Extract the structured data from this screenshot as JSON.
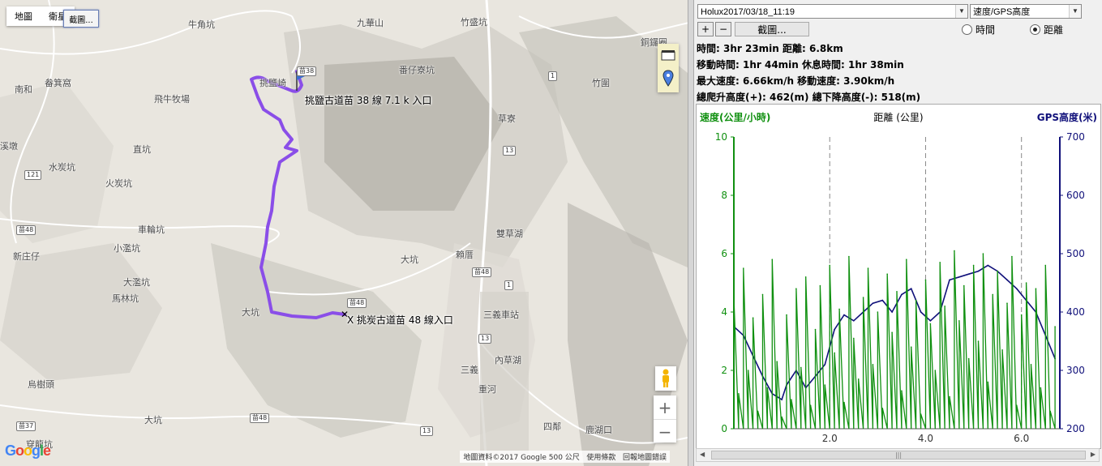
{
  "map": {
    "type_tabs": [
      "地圖",
      "衛星"
    ],
    "screenshot_label": "截圖...",
    "attribution": "地圖資料©2017 Google  500 公尺",
    "terms": "使用條款",
    "report": "回報地圖錯誤",
    "google_logo": "Google",
    "labels": [
      {
        "text": "牛角坑"
      },
      {
        "text": "九華山"
      },
      {
        "text": "竹盛坑"
      },
      {
        "text": "銅鑼圈"
      },
      {
        "text": "南和"
      },
      {
        "text": "畚箕窩"
      },
      {
        "text": "番仔寮坑"
      },
      {
        "text": "挑鹽崎"
      },
      {
        "text": "飛牛牧場"
      },
      {
        "text": "竹圍"
      },
      {
        "text": "溪墩"
      },
      {
        "text": "直坑"
      },
      {
        "text": "草寮"
      },
      {
        "text": "水炭坑"
      },
      {
        "text": "火炭坑"
      },
      {
        "text": "車輪坑"
      },
      {
        "text": "雙草湖"
      },
      {
        "text": "小濫坑"
      },
      {
        "text": "新庄仔"
      },
      {
        "text": "賴厝"
      },
      {
        "text": "大坑"
      },
      {
        "text": "大濫坑"
      },
      {
        "text": "馬林坑"
      },
      {
        "text": "大坑"
      },
      {
        "text": "三義車站"
      },
      {
        "text": "內草湖"
      },
      {
        "text": "三義"
      },
      {
        "text": "烏樹頭"
      },
      {
        "text": "重河"
      },
      {
        "text": "大坑"
      },
      {
        "text": "四鄰"
      },
      {
        "text": "鹿湖口"
      },
      {
        "text": "穿龍坑"
      }
    ],
    "shields": [
      "苗38",
      "121",
      "苗48",
      "苗48",
      "苗48",
      "13",
      "13",
      "苗48",
      "苗37",
      "13",
      "1",
      "1"
    ],
    "route_labels": {
      "start": "挑鹽古道苗 38 線 7.1 k 入口",
      "end": "X 挑炭古道苗 48 線入口"
    },
    "route_color": "#8a4ee8"
  },
  "panel": {
    "track_select": "Holux2017/03/18_11:19",
    "mode_select": "速度/GPS高度",
    "zoom_in": "+",
    "zoom_out": "−",
    "screenshot_button": "截圖...",
    "radio_time": "時間",
    "radio_distance": "距離",
    "radio_selected": "distance",
    "stats": {
      "line1": "時間: 3hr 23min  距離: 6.8km",
      "line2": "移動時間: 1hr 44min  休息時間: 1hr 38min",
      "line3": "最大速度: 6.66km/h  移動速度: 3.90km/h",
      "line4": "總爬升高度(+): 462(m)  總下降高度(-): 518(m)"
    }
  },
  "chart_data": {
    "type": "line",
    "xlabel": "距離 (公里)",
    "ylabel_left": "速度(公里/小時)",
    "ylabel_right": "GPS高度(米)",
    "xlim": [
      0,
      6.8
    ],
    "ylim_left": [
      0,
      10
    ],
    "ylim_right": [
      200,
      700
    ],
    "x_ticks": [
      "2.0",
      "4.0",
      "6.0"
    ],
    "y_ticks_left": [
      "0",
      "2",
      "4",
      "6",
      "8",
      "10"
    ],
    "y_ticks_right": [
      "200",
      "300",
      "400",
      "500",
      "600",
      "700"
    ],
    "colors": {
      "speed": "#109010",
      "altitude": "#10107a",
      "left_axis": "#109010",
      "right_axis": "#10107a"
    },
    "series": [
      {
        "axis": "right",
        "x": [
          0,
          0.2,
          0.4,
          0.6,
          0.8,
          1.0,
          1.1,
          1.3,
          1.5,
          1.7,
          1.9,
          2.1,
          2.3,
          2.5,
          2.7,
          2.9,
          3.1,
          3.3,
          3.5,
          3.7,
          3.9,
          4.1,
          4.3,
          4.5,
          4.7,
          4.9,
          5.1,
          5.3,
          5.5,
          5.7,
          5.9,
          6.1,
          6.3,
          6.5,
          6.7
        ],
        "y": [
          375,
          360,
          325,
          290,
          260,
          250,
          275,
          300,
          270,
          290,
          310,
          370,
          395,
          385,
          400,
          415,
          420,
          400,
          430,
          440,
          400,
          385,
          400,
          455,
          460,
          465,
          470,
          480,
          470,
          455,
          440,
          420,
          400,
          360,
          320
        ]
      },
      {
        "axis": "left",
        "x": [
          0,
          0.1,
          0.2,
          0.3,
          0.4,
          0.5,
          0.6,
          0.7,
          0.8,
          0.9,
          1.0,
          1.1,
          1.2,
          1.3,
          1.4,
          1.5,
          1.6,
          1.7,
          1.8,
          1.9,
          2.0,
          2.1,
          2.2,
          2.3,
          2.4,
          2.5,
          2.6,
          2.7,
          2.8,
          2.9,
          3.0,
          3.1,
          3.2,
          3.3,
          3.4,
          3.5,
          3.6,
          3.7,
          3.8,
          3.9,
          4.0,
          4.1,
          4.2,
          4.3,
          4.4,
          4.5,
          4.6,
          4.7,
          4.8,
          4.9,
          5.0,
          5.1,
          5.2,
          5.3,
          5.4,
          5.5,
          5.6,
          5.7,
          5.8,
          5.9,
          6.0,
          6.1,
          6.2,
          6.3,
          6.4,
          6.5,
          6.6,
          6.7
        ],
        "y": [
          4.5,
          1.2,
          5.5,
          2.0,
          3.8,
          0.6,
          4.6,
          1.4,
          5.8,
          2.3,
          0.4,
          3.9,
          1.0,
          4.8,
          2.1,
          5.2,
          0.8,
          3.4,
          4.9,
          1.5,
          5.6,
          2.6,
          4.1,
          0.9,
          5.9,
          3.1,
          1.7,
          4.5,
          5.5,
          2.2,
          4.0,
          0.7,
          5.3,
          3.3,
          4.7,
          1.3,
          5.8,
          2.8,
          4.4,
          0.5,
          5.1,
          3.6,
          2.0,
          5.7,
          4.2,
          1.1,
          6.1,
          3.7,
          4.9,
          2.4,
          5.6,
          3.0,
          6.0,
          1.6,
          4.6,
          5.4,
          2.7,
          4.3,
          5.9,
          0.8,
          3.9,
          5.0,
          2.2,
          4.8,
          1.4,
          5.6,
          0.6,
          3.5
        ]
      }
    ]
  }
}
